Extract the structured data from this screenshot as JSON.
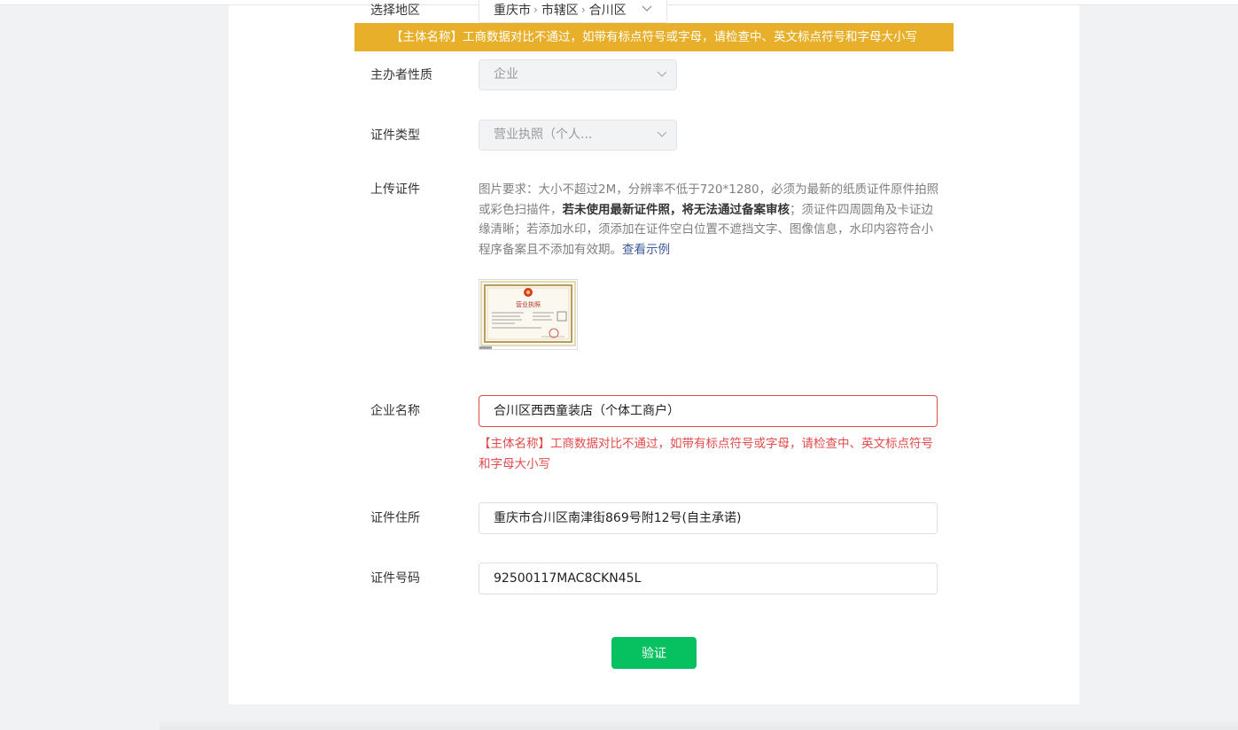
{
  "region": {
    "label": "选择地区",
    "province": "重庆市",
    "city": "市辖区",
    "district": "合川区",
    "separator": "›"
  },
  "banner": {
    "text": "【主体名称】工商数据对比不通过，如带有标点符号或字母，请检查中、英文标点符号和字母大小写",
    "color": "#e8b02a"
  },
  "organizer_type": {
    "label": "主办者性质",
    "value": "企业"
  },
  "certificate_type": {
    "label": "证件类型",
    "value": "营业执照（个人..."
  },
  "upload": {
    "label": "上传证件",
    "desc_part1": "图片要求：大小不超过2M，分辨率不低于720*1280，必须为最新的纸质证件原件拍照或彩色扫描件，",
    "desc_bold": "若未使用最新证件照，将无法通过备案审核",
    "desc_part2": "；须证件四周圆角及卡证边缘清晰；若添加水印，须添加在证件空白位置不遮挡文字、图像信息，水印内容符合小程序备案且不添加有效期。",
    "example_link": "查看示例",
    "thumbnail_title": "营业执照"
  },
  "company_name": {
    "label": "企业名称",
    "value": "合川区西西童装店（个体工商户）",
    "error": "【主体名称】工商数据对比不通过，如带有标点符号或字母，请检查中、英文标点符号和字母大小写"
  },
  "certificate_address": {
    "label": "证件住所",
    "value": "重庆市合川区南津街869号附12号(自主承诺)"
  },
  "certificate_number": {
    "label": "证件号码",
    "value": "92500117MAC8CKN45L"
  },
  "verify_button": {
    "label": "验证",
    "color": "#07c160"
  },
  "icons": {
    "caret": "chevron-down-icon"
  }
}
